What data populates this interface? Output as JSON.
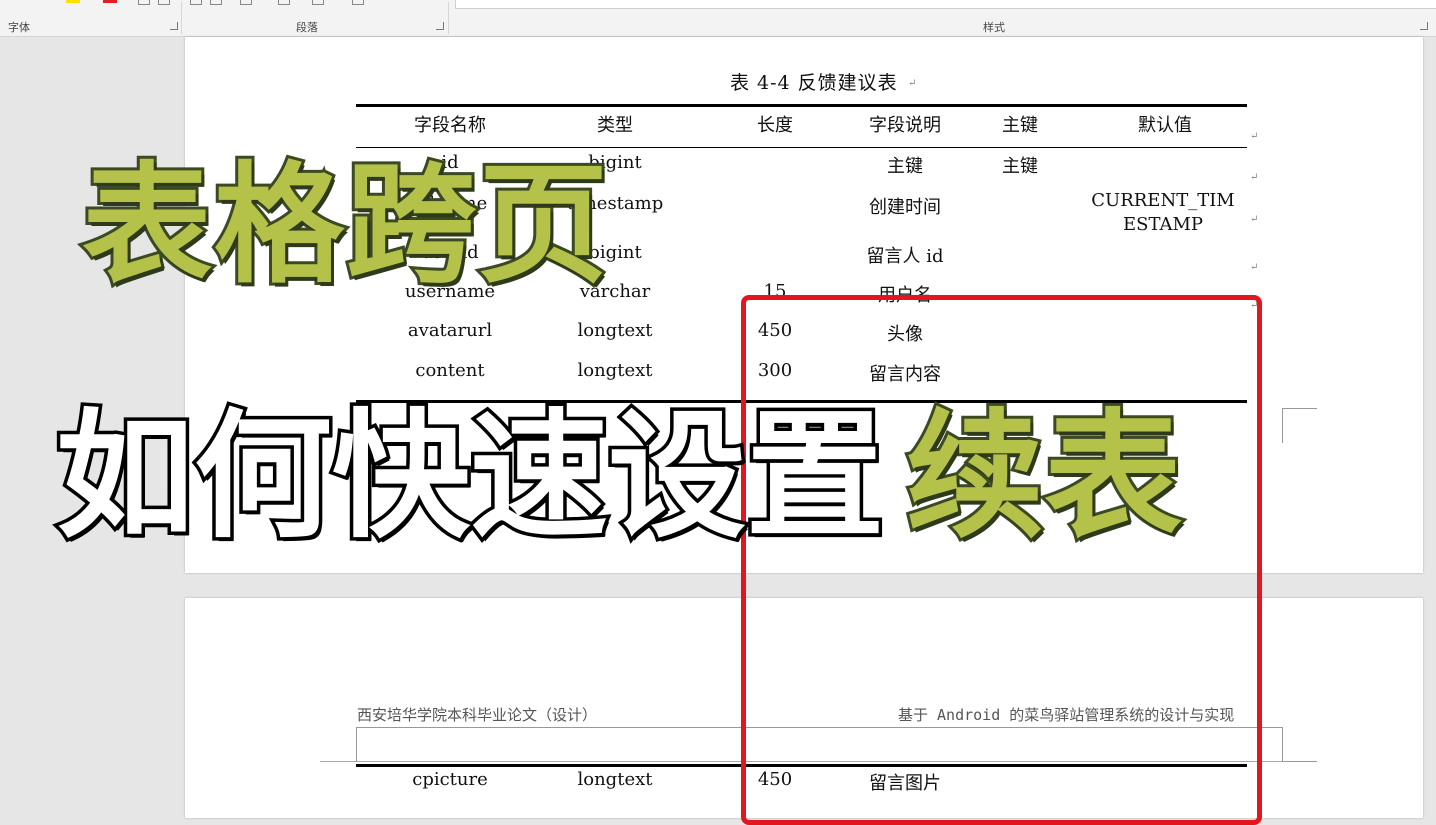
{
  "ribbon": {
    "groups": [
      "字体",
      "段落",
      "样式"
    ],
    "colors": {
      "highlight": "#ffe100",
      "font_red": "#e51c23",
      "ribbon_bg": "#f3f3f3"
    }
  },
  "table": {
    "caption": "表 4-4  反馈建议表",
    "headers": [
      "字段名称",
      "类型",
      "长度",
      "字段说明",
      "主键",
      "默认值"
    ],
    "rows": [
      {
        "name": "id",
        "type": "bigint",
        "length": "",
        "desc": "主键",
        "pk": "主键",
        "default": ""
      },
      {
        "name": "addtime",
        "type": "timestamp",
        "length": "",
        "desc": "创建时间",
        "pk": "",
        "default_line1": "CURRENT_TIM",
        "default_line2": "ESTAMP"
      },
      {
        "name": "userid",
        "type": "bigint",
        "length": "",
        "desc": "留言人 id",
        "pk": "",
        "default": ""
      },
      {
        "name": "username",
        "type": "varchar",
        "length": "15",
        "desc": "用户名",
        "pk": "",
        "default": ""
      },
      {
        "name": "avatarurl",
        "type": "longtext",
        "length": "450",
        "desc": "头像",
        "pk": "",
        "default": ""
      },
      {
        "name": "content",
        "type": "longtext",
        "length": "300",
        "desc": "留言内容",
        "pk": "",
        "default": ""
      }
    ],
    "continued_rows": [
      {
        "name": "cpicture",
        "type": "longtext",
        "length": "450",
        "desc": "留言图片",
        "pk": "",
        "default": ""
      }
    ]
  },
  "page_header": {
    "left": "西安培华学院本科毕业论文（设计）",
    "right": "基于 Android 的菜鸟驿站管理系统的设计与实现"
  },
  "overlay": {
    "line1": "表格跨页",
    "line2_white": "如何快速设置",
    "line2_green": "续表",
    "colors": {
      "green": "#b5c24a",
      "outline": "#3b4a22",
      "highlight_box": "#e3161f"
    }
  },
  "paragraph_mark": "↵"
}
